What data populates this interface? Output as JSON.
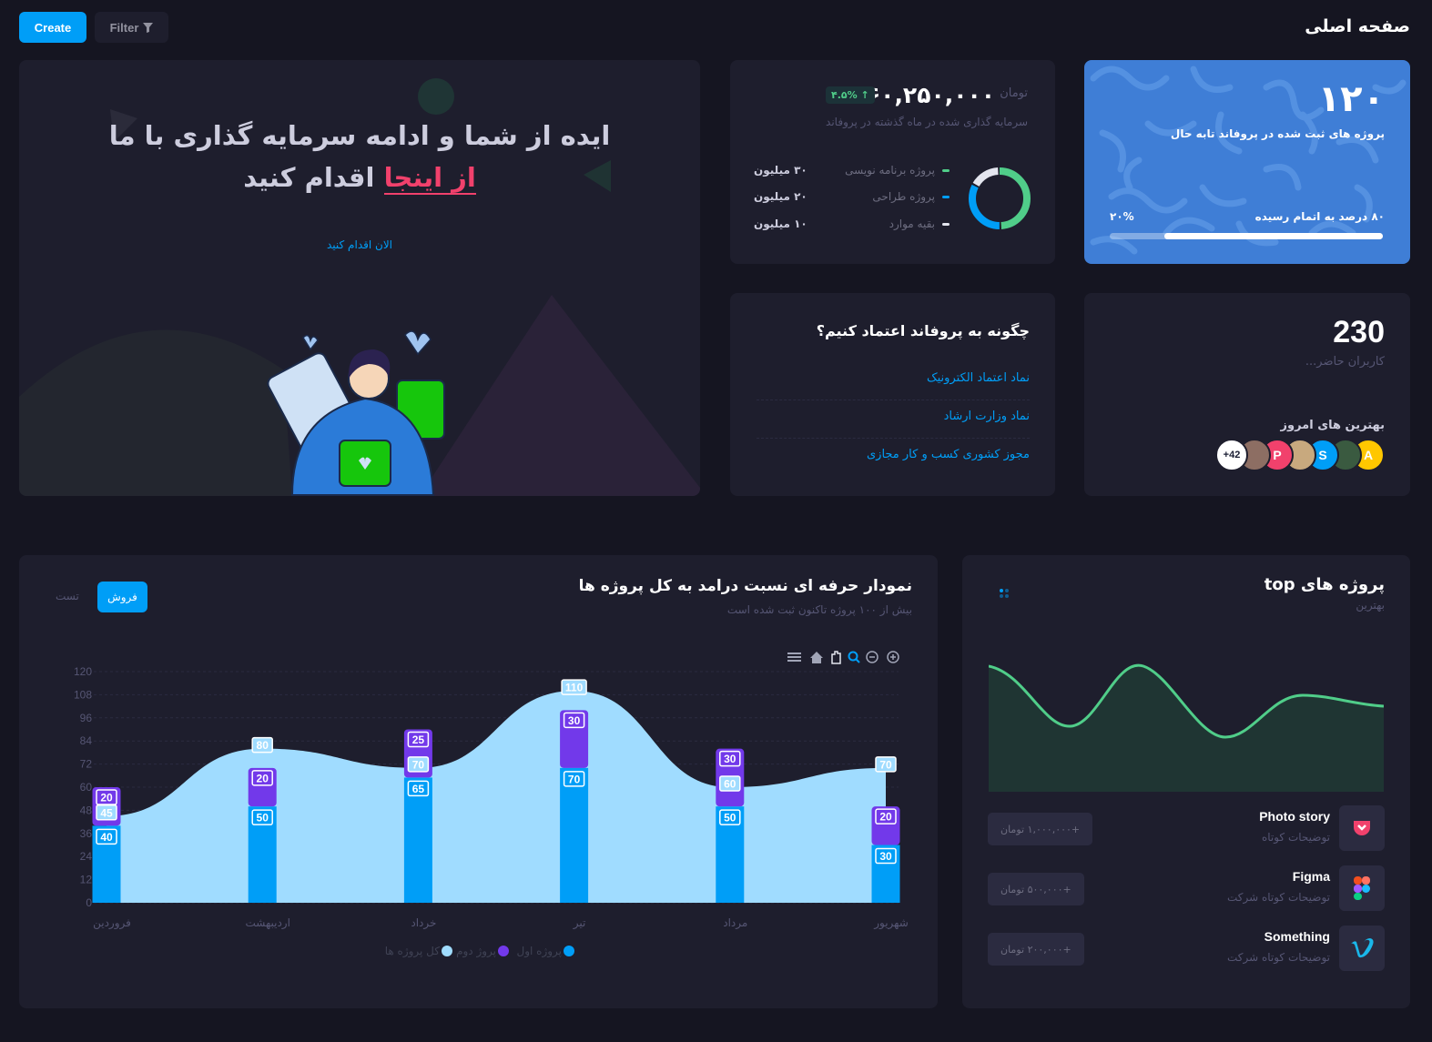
{
  "header": {
    "create_label": "Create",
    "filter_label": "Filter",
    "page_title": "صفحه اصلی"
  },
  "hero": {
    "title_line1": "ایده از شما و ادامه سرمایه گذاری با ما",
    "title_highlight": "از اینجا",
    "title_line2_rest": " اقدام کنید",
    "cta_link": "الان اقدام کنید"
  },
  "investment": {
    "currency": "تومان",
    "amount": "۶۰,۲۵۰,۰۰۰",
    "change_badge": "۴.۵%",
    "subtitle": "سرمایه گذاری شده در ماه گذشته در پروفاند",
    "legend": [
      {
        "label": "پروژه برنامه نویسی",
        "value": "۳۰ میلیون",
        "color": "#50cd89"
      },
      {
        "label": "پروژه طراحی",
        "value": "۲۰ میلیون",
        "color": "#009ef7"
      },
      {
        "label": "بقیه موارد",
        "value": "۱۰ میلیون",
        "color": "#e4e6ef"
      }
    ],
    "donut_fractions": [
      0.5,
      0.333,
      0.167
    ]
  },
  "projects": {
    "count": "۱۲۰",
    "label": "پروژه های ثبت شده در پروفاند تابه حال",
    "progress_label": "۸۰ درصد به اتمام رسیده",
    "progress_pct": "۲۰%",
    "progress_fill": 0.8
  },
  "trust": {
    "title": "چگونه به پروفاند اعتماد کنیم؟",
    "links": [
      "نماد اعتماد الکترونیک",
      "نماد وزارت ارشاد",
      "مجوز کشوری کسب و کار مجازی"
    ]
  },
  "users": {
    "count": "230",
    "label": "کاربران حاضر...",
    "best_title": "بهترین های امروز",
    "avatars": [
      {
        "text": "A",
        "color": "#ffc700"
      },
      {
        "text": "",
        "color": "#3a5a40"
      },
      {
        "text": "S",
        "color": "#009ef7"
      },
      {
        "text": "",
        "color": "#c8a97e"
      },
      {
        "text": "P",
        "color": "#f1416c"
      },
      {
        "text": "",
        "color": "#8d6e63"
      },
      {
        "text": "+42",
        "color": "#ffffff"
      }
    ]
  },
  "chart_card": {
    "title": "نمودار حرفه ای نسبت درامد به کل پروژه ها",
    "subtitle": "بیش از ۱۰۰ پروژه تاکنون ثبت شده است",
    "tab_active": "فروش",
    "tab_other": "تست"
  },
  "chart_data": {
    "type": "bar",
    "categories": [
      "فروردین",
      "اردیبهشت",
      "خرداد",
      "تیر",
      "مرداد",
      "شهریور"
    ],
    "series": [
      {
        "name": "پروژه اول",
        "type": "bar",
        "values": [
          40,
          50,
          65,
          70,
          50,
          30
        ],
        "color": "#009ef7"
      },
      {
        "name": "پروژ دوم",
        "type": "bar",
        "values": [
          20,
          20,
          25,
          30,
          30,
          20
        ],
        "color": "#7239ea"
      },
      {
        "name": "کل پروژه ها",
        "type": "area",
        "values": [
          45,
          80,
          70,
          110,
          60,
          70
        ],
        "color": "#a0dcff"
      }
    ],
    "ylim": [
      0,
      120
    ],
    "yticks": [
      0,
      12,
      24,
      36,
      48,
      60,
      72,
      84,
      96,
      108,
      120
    ],
    "grid": true,
    "legend": "bottom"
  },
  "top_projects": {
    "title": "پروژه های top",
    "subtitle": "بهترین",
    "items": [
      {
        "name": "Photo story",
        "desc": "توضیحات کوتاه",
        "price": "+۱,۰۰۰,۰۰۰ تومان",
        "icon": "pocket-icon"
      },
      {
        "name": "Figma",
        "desc": "توضیحات کوتاه شرکت",
        "price": "+۵۰۰,۰۰۰ تومان",
        "icon": "figma-icon"
      },
      {
        "name": "Something",
        "desc": "توضیحات کوتاه شرکت",
        "price": "+۲۰۰,۰۰۰ تومان",
        "icon": "vimeo-icon"
      }
    ]
  }
}
